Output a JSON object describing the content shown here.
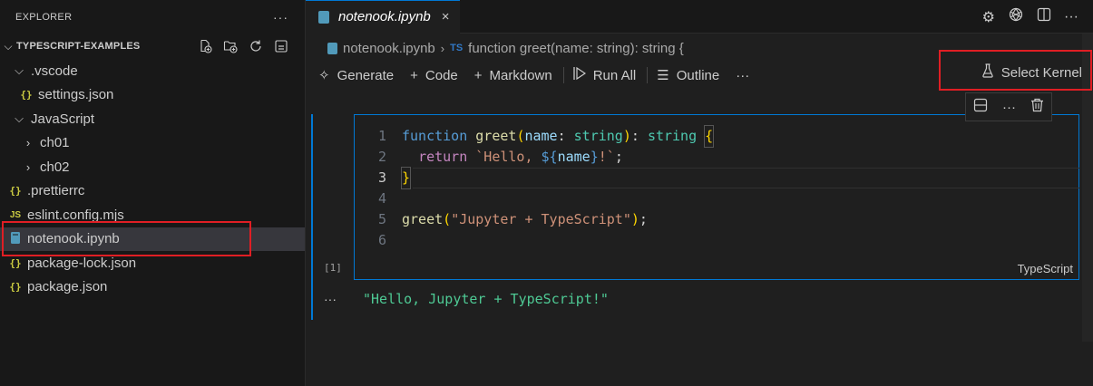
{
  "sidebar": {
    "title": "EXPLORER",
    "more_icon": "ellipsis-icon",
    "section": "TYPESCRIPT-EXAMPLES",
    "actions": [
      "new-file-icon",
      "new-folder-icon",
      "refresh-icon",
      "collapse-all-icon"
    ],
    "items": [
      {
        "label": ".vscode",
        "kind": "folder-open",
        "depth": 1
      },
      {
        "label": "settings.json",
        "kind": "json",
        "depth": 2
      },
      {
        "label": "JavaScript",
        "kind": "folder-open",
        "depth": 1
      },
      {
        "label": "ch01",
        "kind": "folder-closed",
        "depth": 2
      },
      {
        "label": "ch02",
        "kind": "folder-closed",
        "depth": 2
      },
      {
        "label": ".prettierrc",
        "kind": "json",
        "depth": 1
      },
      {
        "label": "eslint.config.mjs",
        "kind": "js",
        "depth": 1
      },
      {
        "label": "notenook.ipynb",
        "kind": "notebook",
        "depth": 1,
        "selected": true
      },
      {
        "label": "package-lock.json",
        "kind": "json",
        "depth": 1
      },
      {
        "label": "package.json",
        "kind": "json",
        "depth": 1
      }
    ]
  },
  "tab": {
    "label": "notenook.ipynb",
    "close": "×"
  },
  "tab_actions": [
    "settings-gear-icon",
    "openai-icon",
    "split-editor-icon",
    "more-actions-icon"
  ],
  "breadcrumb": {
    "file": "notenook.ipynb",
    "ts_badge": "TS",
    "symbol": "function greet(name: string): string {"
  },
  "toolbar": {
    "generate": "Generate",
    "code": "Code",
    "markdown": "Markdown",
    "run_all": "Run All",
    "outline": "Outline",
    "more": "···",
    "select_kernel": "Select Kernel"
  },
  "cell": {
    "line_numbers": [
      "1",
      "2",
      "3",
      "4",
      "5",
      "6"
    ],
    "language": "TypeScript",
    "exec_count": "[1]",
    "output": "\"Hello, Jupyter + TypeScript!\""
  },
  "colors": {
    "accent": "#0078d4",
    "highlight_box": "#e01e24"
  }
}
